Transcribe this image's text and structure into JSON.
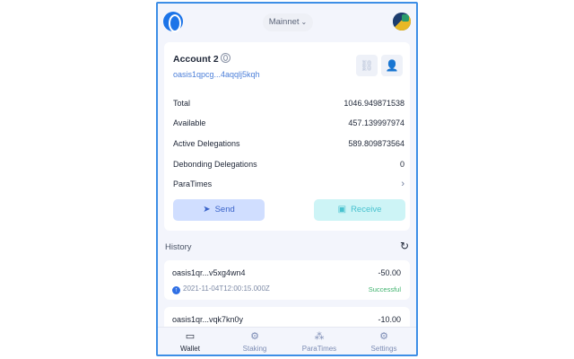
{
  "header": {
    "network_label": "Mainnet",
    "logo_icon": "oasis-logo-icon",
    "avatar_icon": "account-avatar"
  },
  "account": {
    "name": "Account 2",
    "address": "oasis1qpcg...4aqqlj5kqh",
    "balances": [
      {
        "label": "Total",
        "value": "1046.949871538"
      },
      {
        "label": "Available",
        "value": "457.139997974"
      },
      {
        "label": "Active Delegations",
        "value": "589.809873564"
      },
      {
        "label": "Debonding Delegations",
        "value": "0"
      },
      {
        "label": "ParaTimes",
        "value": ""
      }
    ],
    "send_label": "Send",
    "receive_label": "Receive"
  },
  "history": {
    "title": "History",
    "transactions": [
      {
        "address": "oasis1qr...v5xg4wn4",
        "amount": "-50.00",
        "timestamp": "2021-11-04T12:00:15.000Z",
        "status": "Successful"
      },
      {
        "address": "oasis1qr...vqk7kn0y",
        "amount": "-10.00"
      }
    ]
  },
  "nav": {
    "items": [
      {
        "label": "Wallet",
        "icon": "wallet-icon"
      },
      {
        "label": "Staking",
        "icon": "staking-icon"
      },
      {
        "label": "ParaTimes",
        "icon": "paratimes-icon"
      },
      {
        "label": "Settings",
        "icon": "settings-icon"
      }
    ]
  },
  "colors": {
    "accent": "#3d8ee6",
    "send_bg": "#d0deff",
    "receive_bg": "#cdf4f6",
    "success": "#3fb26d"
  }
}
